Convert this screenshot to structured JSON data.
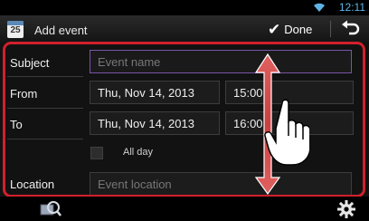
{
  "status": {
    "time": "12:11"
  },
  "header": {
    "icon_number": "25",
    "title": "Add event",
    "done_label": "Done"
  },
  "form": {
    "subject": {
      "label": "Subject",
      "placeholder": "Event name"
    },
    "from": {
      "label": "From",
      "date": "Thu, Nov 14, 2013",
      "time": "15:00"
    },
    "to": {
      "label": "To",
      "date": "Thu, Nov 14, 2013",
      "time": "16:00"
    },
    "allday": {
      "label": "All day",
      "checked": false
    },
    "location": {
      "label": "Location",
      "placeholder": "Event location"
    }
  },
  "colors": {
    "highlight_frame": "#d2202c",
    "status_accent": "#5fb4e6",
    "focus_border": "#7b54a7"
  },
  "icons": [
    "wifi-icon",
    "calendar-icon",
    "check-icon",
    "back-icon",
    "search-icon",
    "gear-icon",
    "scroll-gesture-icon"
  ]
}
